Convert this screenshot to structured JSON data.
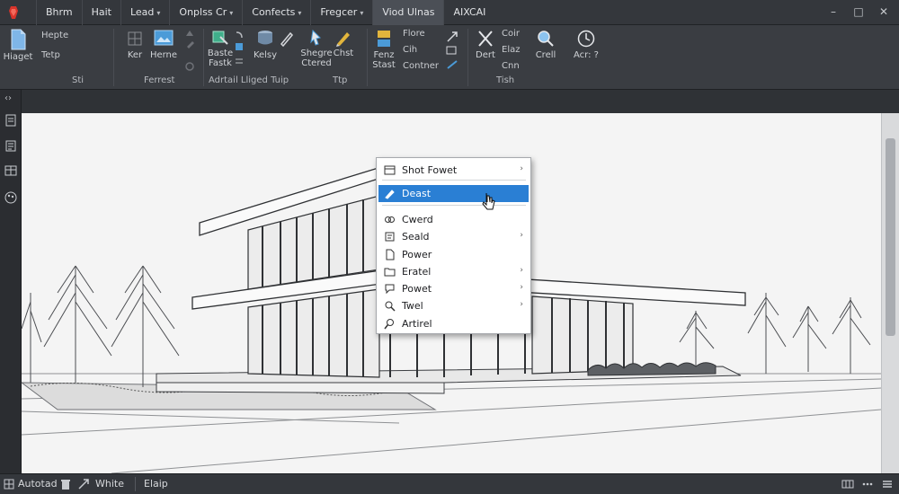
{
  "titlebar": {
    "menus": [
      {
        "label": "Bhrm",
        "chevron": false
      },
      {
        "label": "Hait",
        "chevron": false
      },
      {
        "label": "Lead",
        "chevron": true
      },
      {
        "label": "Onplss Cr",
        "chevron": true
      },
      {
        "label": "Confects",
        "chevron": true
      },
      {
        "label": "Fregcer",
        "chevron": true
      },
      {
        "label": "Viod Ulnas",
        "chevron": false
      },
      {
        "label": "AIXCAI",
        "chevron": false
      }
    ],
    "window_controls": [
      "minimize-icon",
      "restore-icon",
      "close-icon"
    ]
  },
  "ribbon": {
    "buttons": {
      "hiaget": "Hiaget",
      "hepte": "Hepte",
      "tetp": "Tetp",
      "ker": "Ker",
      "herne": "Herne",
      "baste_fastk": "Baste\nFastk",
      "kelsy": "Kelsy",
      "shegre_ctered": "Shegre\nCtered",
      "chst": "Chst",
      "fenz_stast": "Fenz\nStast",
      "flore": "Flore",
      "cih": "Cih",
      "contner": "Contner",
      "dert": "Dert",
      "coir": "Coir",
      "elaz": "Elaz",
      "cnn": "Cnn",
      "crell": "Crell",
      "acr": "Acr: ?"
    },
    "group_labels": [
      "Sti",
      "Ferrest",
      "Adrtail Lliged Tuip",
      "Ttp",
      "Tish"
    ]
  },
  "context_menu": {
    "items": [
      {
        "label": "Shot Fowet",
        "icon": "window-icon",
        "submenu": true,
        "selected": false
      },
      {
        "label": "Deast",
        "icon": "pencil-icon",
        "submenu": false,
        "selected": true
      },
      {
        "label": "Cwerd",
        "icon": "link-icon",
        "submenu": false,
        "selected": false
      },
      {
        "label": "Seald",
        "icon": "seal-icon",
        "submenu": true,
        "selected": false
      },
      {
        "label": "Power",
        "icon": "page-icon",
        "submenu": false,
        "selected": false
      },
      {
        "label": "Eratel",
        "icon": "folder-icon",
        "submenu": true,
        "selected": false
      },
      {
        "label": "Powet",
        "icon": "chat-icon",
        "submenu": true,
        "selected": false
      },
      {
        "label": "Twel",
        "icon": "magnifier-icon",
        "submenu": true,
        "selected": false
      },
      {
        "label": "Artirel",
        "icon": "search-icon",
        "submenu": false,
        "selected": false
      }
    ]
  },
  "statusbar": {
    "autosave_label": "Autotad",
    "white_label": "White",
    "help_label": "Elaip"
  },
  "colors": {
    "chrome": "#2b2d31",
    "ribbon": "#3a3d42",
    "canvas": "#f4f4f4",
    "selection": "#2a7fd4",
    "accent": "#e03c31"
  }
}
